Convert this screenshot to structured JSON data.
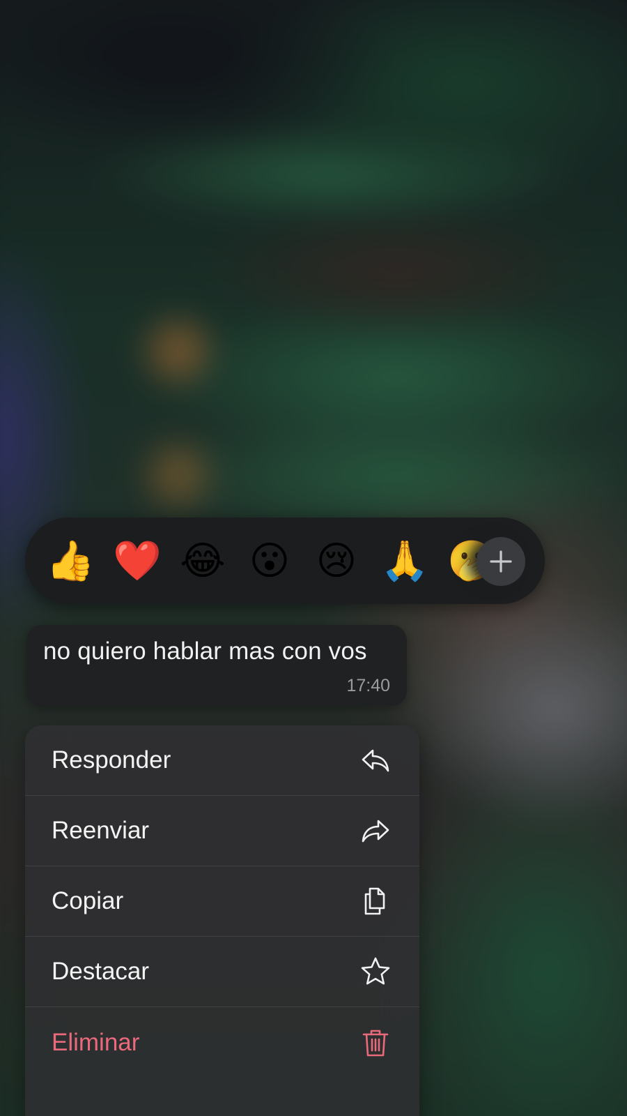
{
  "reactions": {
    "emojis": [
      {
        "name": "thumbs-up",
        "glyph": "👍"
      },
      {
        "name": "red-heart",
        "glyph": "❤️"
      },
      {
        "name": "tears-of-joy",
        "glyph": "😂"
      },
      {
        "name": "surprised-face",
        "glyph": "😮"
      },
      {
        "name": "crying-face",
        "glyph": "😢"
      },
      {
        "name": "folded-hands",
        "glyph": "🙏"
      },
      {
        "name": "partial-face",
        "glyph": "🫢"
      }
    ],
    "add_label": "+"
  },
  "message": {
    "text": "no quiero hablar mas con vos",
    "time": "17:40"
  },
  "menu": {
    "items": [
      {
        "label": "Responder",
        "icon": "reply-icon",
        "danger": false
      },
      {
        "label": "Reenviar",
        "icon": "forward-icon",
        "danger": false
      },
      {
        "label": "Copiar",
        "icon": "copy-icon",
        "danger": false
      },
      {
        "label": "Destacar",
        "icon": "star-icon",
        "danger": false
      },
      {
        "label": "Eliminar",
        "icon": "trash-icon",
        "danger": true
      }
    ]
  },
  "colors": {
    "danger": "#ea6a7c",
    "menu_text": "#f4f4f4",
    "bubble_bg": "#1f2123"
  }
}
